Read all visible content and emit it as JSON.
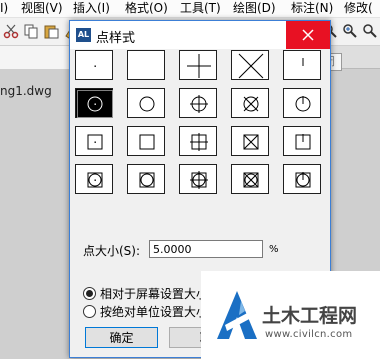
{
  "menu": {
    "items": [
      {
        "label": "视图(V)"
      },
      {
        "label": "插入(I)"
      },
      {
        "label": "格式(O)"
      },
      {
        "label": "工具(T)"
      },
      {
        "label": "绘图(D)"
      },
      {
        "label": "标注(N)"
      },
      {
        "label": "修改("
      }
    ],
    "partial_left": "I)"
  },
  "drawing": {
    "file_tab": "ng1.dwg",
    "tooltip": "关闭"
  },
  "dialog": {
    "title": "点样式",
    "app_icon_text": "AL",
    "styles": [
      "dot",
      "none",
      "plus",
      "cross",
      "tick",
      "circle-dot",
      "circle",
      "circle-plus",
      "circle-cross",
      "circle-tick",
      "square-dot",
      "square",
      "square-plus",
      "square-cross",
      "square-tick",
      "square-circle-dot",
      "square-circle",
      "square-circle-plus",
      "square-circle-cross",
      "square-circle-tick"
    ],
    "selected_style_index": 5,
    "size_label": "点大小(S):",
    "size_value": "5.0000",
    "size_unit": "%",
    "radio_relative": "相对于屏幕设置大小",
    "radio_absolute": "按绝对单位设置大小",
    "selected_radio": "relative",
    "ok_label": "确定",
    "cancel_label": "取"
  },
  "watermark": {
    "title": "土木工程网",
    "url": "www.civilcn.com"
  },
  "colors": {
    "close_red": "#e81123",
    "dialog_border": "#3c7fd6",
    "watermark_blue": "#1a6fc4"
  }
}
